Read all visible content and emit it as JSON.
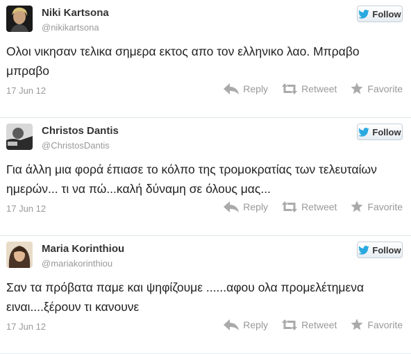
{
  "colors": {
    "follow_bird": "#2aa9e0",
    "muted": "#999999",
    "action_icon": "#aaaaaa"
  },
  "tweets": [
    {
      "name": "Niki Kartsona",
      "handle": "@nikikartsona",
      "follow_label": "Follow",
      "text": "Ολοι νικησαν τελικα σημερα εκτος απο τον ελληνικο λαο. Μπραβο μπραβο",
      "date": "17 Jun 12",
      "reply_label": "Reply",
      "retweet_label": "Retweet",
      "favorite_label": "Favorite"
    },
    {
      "name": "Christos Dantis",
      "handle": "@ChristosDantis",
      "follow_label": "Follow",
      "text": "Για άλλη μια φορά έπιασε το κόλπο της τρομοκρατίας των τελευταίων ημερών... τι να πώ...καλή δύναμη σε όλους μας...",
      "date": "17 Jun 12",
      "reply_label": "Reply",
      "retweet_label": "Retweet",
      "favorite_label": "Favorite"
    },
    {
      "name": "Maria Korinthiou",
      "handle": "@mariakorinthiou",
      "follow_label": "Follow",
      "text": "Σαν τα πρόβατα παμε και ψηφίζουμε ......αφου ολα προμελέτημενα ειναι....ξέρουν τι κανουνε",
      "date": "17 Jun 12",
      "reply_label": "Reply",
      "retweet_label": "Retweet",
      "favorite_label": "Favorite"
    }
  ]
}
